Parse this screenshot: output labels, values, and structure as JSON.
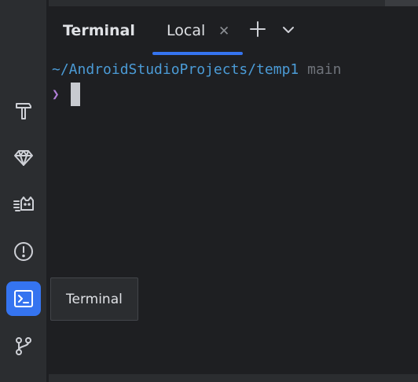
{
  "toolwindow": {
    "title": "Terminal",
    "tabs": [
      {
        "label": "Local",
        "active": true
      }
    ]
  },
  "terminal": {
    "cwd": "~/AndroidStudioProjects/temp1",
    "branch": "main",
    "prompt_symbol": "❯"
  },
  "tooltip": {
    "text": "Terminal"
  },
  "sidebar": {
    "items": [
      {
        "icon": "build-hammer-icon",
        "active": false
      },
      {
        "icon": "gem-icon",
        "active": false
      },
      {
        "icon": "cat-icon",
        "active": false
      },
      {
        "icon": "problems-icon",
        "active": false
      },
      {
        "icon": "terminal-icon",
        "active": true
      },
      {
        "icon": "git-branch-icon",
        "active": false
      }
    ]
  },
  "colors": {
    "background": "#1e1f22",
    "panel": "#2b2d30",
    "accent": "#3574f0",
    "path": "#4b9bd6",
    "branch": "#6f737a",
    "prompt": "#b27fd8"
  }
}
